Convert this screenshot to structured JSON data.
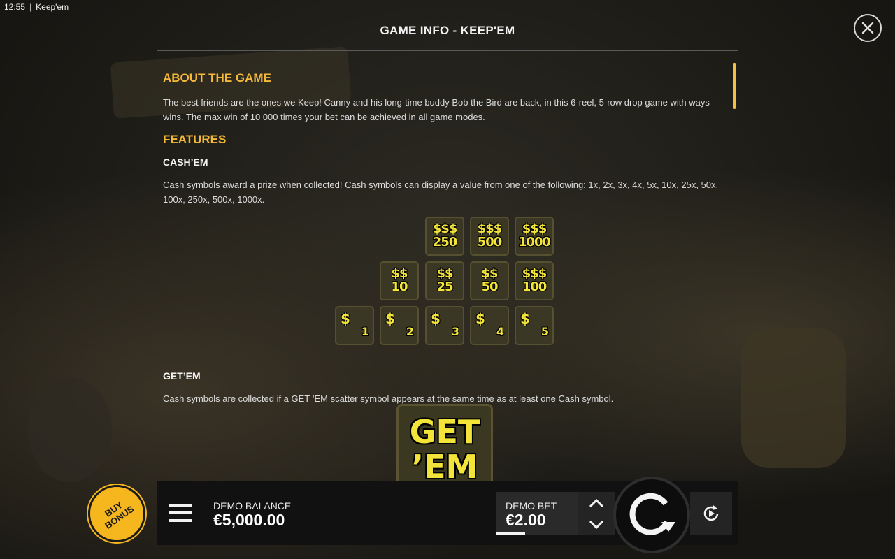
{
  "statusbar": {
    "time": "12:55",
    "separator": "|",
    "app_name": "Keep'em"
  },
  "modal": {
    "title": "GAME INFO - KEEP'EM",
    "close_icon": "close-icon"
  },
  "content": {
    "about": {
      "heading": "ABOUT THE GAME",
      "text": "The best friends are the ones we Keep! Canny and his long-time buddy Bob the Bird are back, in this 6-reel, 5-row drop game with ways wins. The max win of 10 000 times your bet can be achieved in all game modes."
    },
    "features": {
      "heading": "FEATURES",
      "cashem": {
        "heading": "CASH’EM",
        "text": "Cash symbols award a prize when collected! Cash symbols can display a value from one of the following: 1x, 2x, 3x, 4x, 5x, 10x, 25x, 50x, 100x, 250x, 500x, 1000x.",
        "symbols_row1": [
          {
            "dollars": "$$$",
            "value": "250"
          },
          {
            "dollars": "$$$",
            "value": "500"
          },
          {
            "dollars": "$$$",
            "value": "1000"
          }
        ],
        "symbols_row2": [
          {
            "dollars": "$$",
            "value": "10"
          },
          {
            "dollars": "$$",
            "value": "25"
          },
          {
            "dollars": "$$",
            "value": "50"
          },
          {
            "dollars": "$$$",
            "value": "100"
          }
        ],
        "symbols_row3": [
          {
            "dollars": "$",
            "value": "1"
          },
          {
            "dollars": "$",
            "value": "2"
          },
          {
            "dollars": "$",
            "value": "3"
          },
          {
            "dollars": "$",
            "value": "4"
          },
          {
            "dollars": "$",
            "value": "5"
          }
        ]
      },
      "getem": {
        "heading": "GET’EM",
        "text": "Cash symbols are collected if a GET ’EM scatter symbol appears at the same time as at least one Cash symbol.",
        "symbol_line1": "GET",
        "symbol_line2": "’EM"
      }
    }
  },
  "bottom": {
    "buy_bonus": "BUY BONUS",
    "menu_icon": "hamburger-menu-icon",
    "balance_label": "DEMO BALANCE",
    "balance_value": "€5,000.00",
    "bet_label": "DEMO BET",
    "bet_value": "€2.00",
    "bet_level_fraction": 0.36,
    "spin_icon": "spin-icon",
    "autoplay_icon": "autoplay-icon"
  },
  "colors": {
    "accent_yellow": "#f5b93a",
    "buy_bonus": "#f5b61e",
    "symbol_text": "#f3e43a"
  }
}
